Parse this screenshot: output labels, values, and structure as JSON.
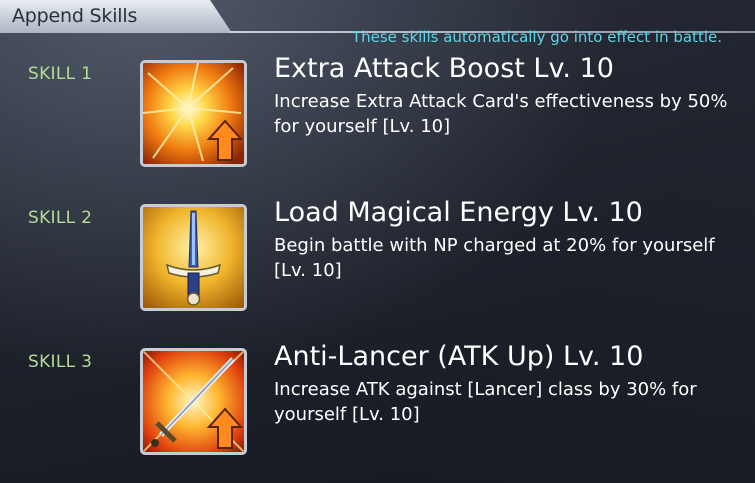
{
  "header": {
    "title": "Append Skills"
  },
  "note": "These skills automatically go into effect in battle.",
  "skills": [
    {
      "label": "SKILL 1",
      "name": "Extra Attack Boost Lv. 10",
      "description": "Increase Extra Attack Card's effectiveness by 50% for yourself [Lv. 10]",
      "icon": "extra-attack-burst-icon"
    },
    {
      "label": "SKILL 2",
      "name": "Load Magical Energy Lv. 10",
      "description": "Begin battle with NP charged at 20% for yourself [Lv. 10]",
      "icon": "sword-icon"
    },
    {
      "label": "SKILL 3",
      "name": "Anti-Lancer (ATK Up) Lv. 10",
      "description": "Increase ATK against [Lancer] class by 30% for yourself [Lv. 10]",
      "icon": "sword-attack-up-icon"
    }
  ],
  "colors": {
    "label_green": "#b4dc97",
    "note_cyan": "#5fd3e6",
    "up_arrow_orange": "#ff8a1e"
  }
}
